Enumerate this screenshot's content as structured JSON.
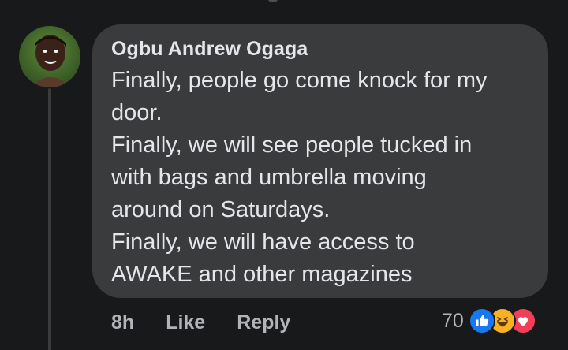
{
  "comment": {
    "author": "Ogbu Andrew Ogaga",
    "lines": [
      "Finally, people go come knock for my",
      "door.",
      "Finally, we will see people tucked in",
      "with bags and umbrella moving",
      "around on Saturdays.",
      "Finally, we will have access to",
      "AWAKE and other magazines"
    ],
    "time": "8h",
    "like_label": "Like",
    "reply_label": "Reply",
    "reaction_count": "70",
    "reactions": [
      "like-icon",
      "haha-icon",
      "love-icon"
    ]
  },
  "colors": {
    "background": "#18191a",
    "bubble": "#3a3b3c",
    "text": "#e4e6eb",
    "muted": "#b0b3b8",
    "like": "#1877f2",
    "haha": "#f7b125",
    "love": "#f33e58"
  }
}
